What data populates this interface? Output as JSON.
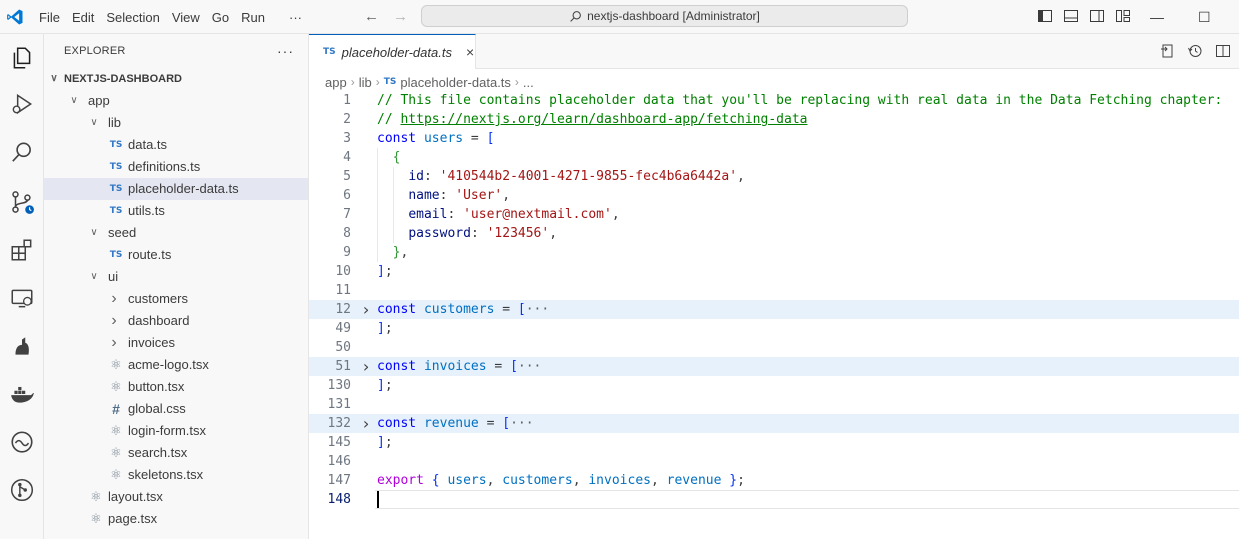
{
  "menu": [
    "File",
    "Edit",
    "Selection",
    "View",
    "Go",
    "Run",
    "···"
  ],
  "command_center": "nextjs-dashboard [Administrator]",
  "explorer": {
    "title": "EXPLORER",
    "more": "···",
    "root": "NEXTJS-DASHBOARD",
    "items": [
      {
        "label": "app",
        "kind": "folder",
        "depth": 1,
        "open": true
      },
      {
        "label": "lib",
        "kind": "folder",
        "depth": 2,
        "open": true
      },
      {
        "label": "data.ts",
        "kind": "ts",
        "depth": 3
      },
      {
        "label": "definitions.ts",
        "kind": "ts",
        "depth": 3
      },
      {
        "label": "placeholder-data.ts",
        "kind": "ts",
        "depth": 3,
        "selected": true
      },
      {
        "label": "utils.ts",
        "kind": "ts",
        "depth": 3
      },
      {
        "label": "seed",
        "kind": "folder",
        "depth": 2,
        "open": true
      },
      {
        "label": "route.ts",
        "kind": "ts",
        "depth": 3
      },
      {
        "label": "ui",
        "kind": "folder",
        "depth": 2,
        "open": true
      },
      {
        "label": "customers",
        "kind": "folder",
        "depth": 3,
        "open": false
      },
      {
        "label": "dashboard",
        "kind": "folder",
        "depth": 3,
        "open": false
      },
      {
        "label": "invoices",
        "kind": "folder",
        "depth": 3,
        "open": false
      },
      {
        "label": "acme-logo.tsx",
        "kind": "tsx",
        "depth": 3
      },
      {
        "label": "button.tsx",
        "kind": "tsx",
        "depth": 3
      },
      {
        "label": "global.css",
        "kind": "css",
        "depth": 3
      },
      {
        "label": "login-form.tsx",
        "kind": "tsx",
        "depth": 3
      },
      {
        "label": "search.tsx",
        "kind": "tsx",
        "depth": 3
      },
      {
        "label": "skeletons.tsx",
        "kind": "tsx",
        "depth": 3
      },
      {
        "label": "layout.tsx",
        "kind": "tsx",
        "depth": 2
      },
      {
        "label": "page.tsx",
        "kind": "tsx",
        "depth": 2
      }
    ]
  },
  "tab": {
    "badge": "TS",
    "name": "placeholder-data.ts",
    "close": "×"
  },
  "breadcrumb": [
    "app",
    "lib",
    "placeholder-data.ts",
    "..."
  ],
  "code_lines": [
    {
      "n": "1",
      "html": [
        [
          "c-com",
          "// This file contains placeholder data that you'll be replacing with real data in the Data Fetching chapter:"
        ]
      ]
    },
    {
      "n": "2",
      "html": [
        [
          "c-com",
          "// "
        ],
        [
          "c-link",
          "https://nextjs.org/learn/dashboard-app/fetching-data"
        ]
      ]
    },
    {
      "n": "3",
      "html": [
        [
          "c-kw",
          "const"
        ],
        [
          "c-pun",
          " "
        ],
        [
          "c-var",
          "users"
        ],
        [
          "c-pun",
          " = "
        ],
        [
          "c-br1",
          "["
        ]
      ]
    },
    {
      "n": "4",
      "html": [
        [
          "c-pun",
          "  "
        ],
        [
          "c-br2",
          "{"
        ]
      ]
    },
    {
      "n": "5",
      "html": [
        [
          "c-pun",
          "    "
        ],
        [
          "c-prop",
          "id"
        ],
        [
          "c-pun",
          ": "
        ],
        [
          "c-str",
          "'410544b2-4001-4271-9855-fec4b6a6442a'"
        ],
        [
          "c-pun",
          ","
        ]
      ]
    },
    {
      "n": "6",
      "html": [
        [
          "c-pun",
          "    "
        ],
        [
          "c-prop",
          "name"
        ],
        [
          "c-pun",
          ": "
        ],
        [
          "c-str",
          "'User'"
        ],
        [
          "c-pun",
          ","
        ]
      ]
    },
    {
      "n": "7",
      "html": [
        [
          "c-pun",
          "    "
        ],
        [
          "c-prop",
          "email"
        ],
        [
          "c-pun",
          ": "
        ],
        [
          "c-str",
          "'user@nextmail.com'"
        ],
        [
          "c-pun",
          ","
        ]
      ]
    },
    {
      "n": "8",
      "html": [
        [
          "c-pun",
          "    "
        ],
        [
          "c-prop",
          "password"
        ],
        [
          "c-pun",
          ": "
        ],
        [
          "c-str",
          "'123456'"
        ],
        [
          "c-pun",
          ","
        ]
      ]
    },
    {
      "n": "9",
      "html": [
        [
          "c-pun",
          "  "
        ],
        [
          "c-br2",
          "}"
        ],
        [
          "c-pun",
          ","
        ]
      ]
    },
    {
      "n": "10",
      "html": [
        [
          "c-br1",
          "]"
        ],
        [
          "c-pun",
          ";"
        ]
      ]
    },
    {
      "n": "11",
      "html": []
    },
    {
      "n": "12",
      "fold": true,
      "html": [
        [
          "c-kw",
          "const"
        ],
        [
          "c-pun",
          " "
        ],
        [
          "c-var",
          "customers"
        ],
        [
          "c-pun",
          " = "
        ],
        [
          "c-br1",
          "["
        ],
        [
          "c-ell",
          "···"
        ]
      ]
    },
    {
      "n": "49",
      "html": [
        [
          "c-br1",
          "]"
        ],
        [
          "c-pun",
          ";"
        ]
      ]
    },
    {
      "n": "50",
      "html": []
    },
    {
      "n": "51",
      "fold": true,
      "html": [
        [
          "c-kw",
          "const"
        ],
        [
          "c-pun",
          " "
        ],
        [
          "c-var",
          "invoices"
        ],
        [
          "c-pun",
          " = "
        ],
        [
          "c-br1",
          "["
        ],
        [
          "c-ell",
          "···"
        ]
      ]
    },
    {
      "n": "130",
      "html": [
        [
          "c-br1",
          "]"
        ],
        [
          "c-pun",
          ";"
        ]
      ]
    },
    {
      "n": "131",
      "html": []
    },
    {
      "n": "132",
      "fold": true,
      "html": [
        [
          "c-kw",
          "const"
        ],
        [
          "c-pun",
          " "
        ],
        [
          "c-var",
          "revenue"
        ],
        [
          "c-pun",
          " = "
        ],
        [
          "c-br1",
          "["
        ],
        [
          "c-ell",
          "···"
        ]
      ]
    },
    {
      "n": "145",
      "html": [
        [
          "c-br1",
          "]"
        ],
        [
          "c-pun",
          ";"
        ]
      ]
    },
    {
      "n": "146",
      "html": []
    },
    {
      "n": "147",
      "html": [
        [
          "c-exp",
          "export"
        ],
        [
          "c-pun",
          " "
        ],
        [
          "c-br1",
          "{"
        ],
        [
          "c-pun",
          " "
        ],
        [
          "c-var",
          "users"
        ],
        [
          "c-pun",
          ", "
        ],
        [
          "c-var",
          "customers"
        ],
        [
          "c-pun",
          ", "
        ],
        [
          "c-var",
          "invoices"
        ],
        [
          "c-pun",
          ", "
        ],
        [
          "c-var",
          "revenue"
        ],
        [
          "c-pun",
          " "
        ],
        [
          "c-br1",
          "}"
        ],
        [
          "c-pun",
          ";"
        ]
      ]
    },
    {
      "n": "148",
      "current": true,
      "html": []
    }
  ],
  "colors": {
    "accent": "#005fb8",
    "ts_badge": "#3178c6",
    "selection": "#e4e6f1",
    "fold_highlight": "#e6f1fb"
  }
}
